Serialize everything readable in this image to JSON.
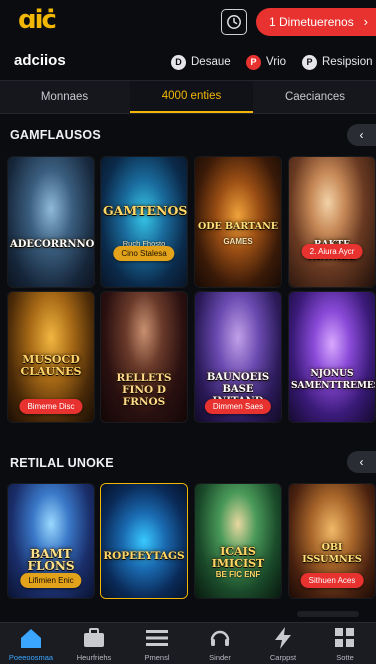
{
  "header": {
    "logo_text": "ɑiċ",
    "promo_label": "1 Dimetuerenos",
    "promo_chevron": "›",
    "accent": "#e8322f",
    "gold": "#f2b705"
  },
  "subheader": {
    "title": "adciios",
    "items": [
      {
        "label": "Desaue",
        "icon": "D"
      },
      {
        "label": "Vrio",
        "icon": "P"
      },
      {
        "label": "Resipsion",
        "icon": "P"
      }
    ]
  },
  "tabs": [
    {
      "label": "Monnaes",
      "active": false
    },
    {
      "label": "4000 enties",
      "active": true
    },
    {
      "label": "Caeciances",
      "active": false
    }
  ],
  "sections": [
    {
      "title": "GAMFLAUSOS",
      "arrow": "‹",
      "cards": [
        {
          "title": "ADECORRNNOS",
          "subtitle": "",
          "button": ""
        },
        {
          "title": "GAMTENOS",
          "subtitle": "Ruch Fhosto",
          "button": "Cino Stalesa"
        },
        {
          "title": "ODE BARTANE",
          "subtitle": "GAMES",
          "button": ""
        },
        {
          "title": "BAKTE NINNIBE",
          "subtitle": "",
          "button": "2. Aiura Aycr"
        },
        {
          "title": "MUSOCD CLAUNES",
          "subtitle": "",
          "button": "Bimeme Disc"
        },
        {
          "title": "RELLETS FINO D FRNOS",
          "subtitle": "",
          "button": ""
        },
        {
          "title": "BAUNOEIS BASE INITAND",
          "subtitle": "",
          "button": "Dimmen Saes"
        },
        {
          "title": "NJONUS SAMENTTREMEST",
          "subtitle": "",
          "button": ""
        }
      ]
    },
    {
      "title": "RETILAL UNOKE",
      "arrow": "‹",
      "cards": [
        {
          "title": "BAMT FLONS",
          "subtitle": "",
          "button": "Lifimien Enic"
        },
        {
          "title": "ROPEEYTAGS",
          "subtitle": "",
          "button": ""
        },
        {
          "title": "ICAIS IMICIST",
          "subtitle": "BE FIC ENF",
          "button": ""
        },
        {
          "title": "OBI ISSUMNES",
          "subtitle": "",
          "button": "Sithuen Aces"
        }
      ]
    }
  ],
  "bottom_nav": [
    {
      "label": "Poeeoosmaa",
      "icon": "home-icon",
      "active": true
    },
    {
      "label": "Heurfriehs",
      "icon": "briefcase-icon",
      "active": false
    },
    {
      "label": "Pmensl",
      "icon": "menu-icon",
      "active": false
    },
    {
      "label": "Sinder",
      "icon": "headset-icon",
      "active": false
    },
    {
      "label": "Carppst",
      "icon": "lightning-icon",
      "active": false
    },
    {
      "label": "Sotte",
      "icon": "grid-icon",
      "active": false
    }
  ]
}
